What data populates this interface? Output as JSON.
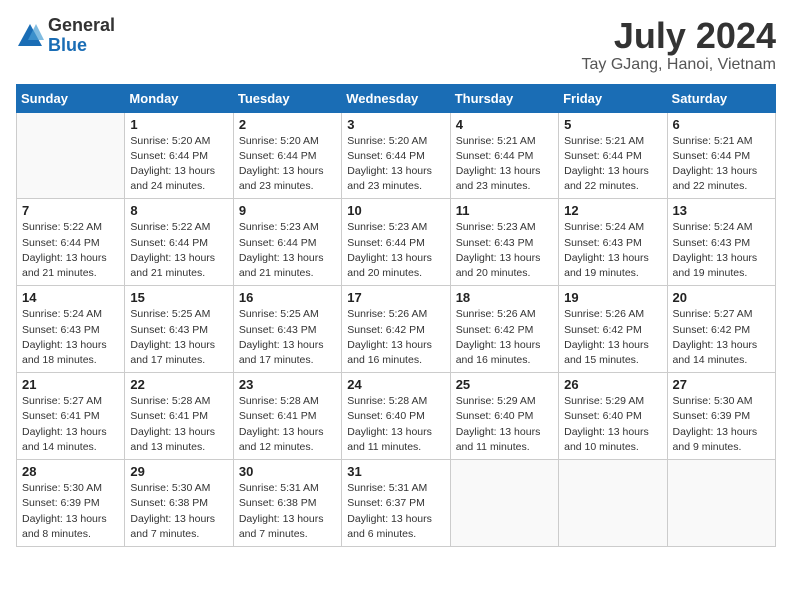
{
  "header": {
    "logo_general": "General",
    "logo_blue": "Blue",
    "month_year": "July 2024",
    "location": "Tay GJang, Hanoi, Vietnam"
  },
  "weekdays": [
    "Sunday",
    "Monday",
    "Tuesday",
    "Wednesday",
    "Thursday",
    "Friday",
    "Saturday"
  ],
  "weeks": [
    [
      {
        "day": "",
        "info": ""
      },
      {
        "day": "1",
        "info": "Sunrise: 5:20 AM\nSunset: 6:44 PM\nDaylight: 13 hours\nand 24 minutes."
      },
      {
        "day": "2",
        "info": "Sunrise: 5:20 AM\nSunset: 6:44 PM\nDaylight: 13 hours\nand 23 minutes."
      },
      {
        "day": "3",
        "info": "Sunrise: 5:20 AM\nSunset: 6:44 PM\nDaylight: 13 hours\nand 23 minutes."
      },
      {
        "day": "4",
        "info": "Sunrise: 5:21 AM\nSunset: 6:44 PM\nDaylight: 13 hours\nand 23 minutes."
      },
      {
        "day": "5",
        "info": "Sunrise: 5:21 AM\nSunset: 6:44 PM\nDaylight: 13 hours\nand 22 minutes."
      },
      {
        "day": "6",
        "info": "Sunrise: 5:21 AM\nSunset: 6:44 PM\nDaylight: 13 hours\nand 22 minutes."
      }
    ],
    [
      {
        "day": "7",
        "info": "Sunrise: 5:22 AM\nSunset: 6:44 PM\nDaylight: 13 hours\nand 21 minutes."
      },
      {
        "day": "8",
        "info": "Sunrise: 5:22 AM\nSunset: 6:44 PM\nDaylight: 13 hours\nand 21 minutes."
      },
      {
        "day": "9",
        "info": "Sunrise: 5:23 AM\nSunset: 6:44 PM\nDaylight: 13 hours\nand 21 minutes."
      },
      {
        "day": "10",
        "info": "Sunrise: 5:23 AM\nSunset: 6:44 PM\nDaylight: 13 hours\nand 20 minutes."
      },
      {
        "day": "11",
        "info": "Sunrise: 5:23 AM\nSunset: 6:43 PM\nDaylight: 13 hours\nand 20 minutes."
      },
      {
        "day": "12",
        "info": "Sunrise: 5:24 AM\nSunset: 6:43 PM\nDaylight: 13 hours\nand 19 minutes."
      },
      {
        "day": "13",
        "info": "Sunrise: 5:24 AM\nSunset: 6:43 PM\nDaylight: 13 hours\nand 19 minutes."
      }
    ],
    [
      {
        "day": "14",
        "info": "Sunrise: 5:24 AM\nSunset: 6:43 PM\nDaylight: 13 hours\nand 18 minutes."
      },
      {
        "day": "15",
        "info": "Sunrise: 5:25 AM\nSunset: 6:43 PM\nDaylight: 13 hours\nand 17 minutes."
      },
      {
        "day": "16",
        "info": "Sunrise: 5:25 AM\nSunset: 6:43 PM\nDaylight: 13 hours\nand 17 minutes."
      },
      {
        "day": "17",
        "info": "Sunrise: 5:26 AM\nSunset: 6:42 PM\nDaylight: 13 hours\nand 16 minutes."
      },
      {
        "day": "18",
        "info": "Sunrise: 5:26 AM\nSunset: 6:42 PM\nDaylight: 13 hours\nand 16 minutes."
      },
      {
        "day": "19",
        "info": "Sunrise: 5:26 AM\nSunset: 6:42 PM\nDaylight: 13 hours\nand 15 minutes."
      },
      {
        "day": "20",
        "info": "Sunrise: 5:27 AM\nSunset: 6:42 PM\nDaylight: 13 hours\nand 14 minutes."
      }
    ],
    [
      {
        "day": "21",
        "info": "Sunrise: 5:27 AM\nSunset: 6:41 PM\nDaylight: 13 hours\nand 14 minutes."
      },
      {
        "day": "22",
        "info": "Sunrise: 5:28 AM\nSunset: 6:41 PM\nDaylight: 13 hours\nand 13 minutes."
      },
      {
        "day": "23",
        "info": "Sunrise: 5:28 AM\nSunset: 6:41 PM\nDaylight: 13 hours\nand 12 minutes."
      },
      {
        "day": "24",
        "info": "Sunrise: 5:28 AM\nSunset: 6:40 PM\nDaylight: 13 hours\nand 11 minutes."
      },
      {
        "day": "25",
        "info": "Sunrise: 5:29 AM\nSunset: 6:40 PM\nDaylight: 13 hours\nand 11 minutes."
      },
      {
        "day": "26",
        "info": "Sunrise: 5:29 AM\nSunset: 6:40 PM\nDaylight: 13 hours\nand 10 minutes."
      },
      {
        "day": "27",
        "info": "Sunrise: 5:30 AM\nSunset: 6:39 PM\nDaylight: 13 hours\nand 9 minutes."
      }
    ],
    [
      {
        "day": "28",
        "info": "Sunrise: 5:30 AM\nSunset: 6:39 PM\nDaylight: 13 hours\nand 8 minutes."
      },
      {
        "day": "29",
        "info": "Sunrise: 5:30 AM\nSunset: 6:38 PM\nDaylight: 13 hours\nand 7 minutes."
      },
      {
        "day": "30",
        "info": "Sunrise: 5:31 AM\nSunset: 6:38 PM\nDaylight: 13 hours\nand 7 minutes."
      },
      {
        "day": "31",
        "info": "Sunrise: 5:31 AM\nSunset: 6:37 PM\nDaylight: 13 hours\nand 6 minutes."
      },
      {
        "day": "",
        "info": ""
      },
      {
        "day": "",
        "info": ""
      },
      {
        "day": "",
        "info": ""
      }
    ]
  ]
}
